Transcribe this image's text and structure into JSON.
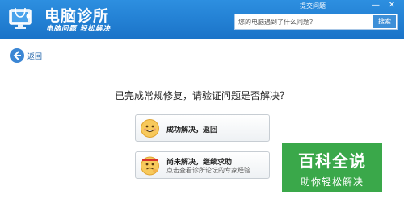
{
  "header": {
    "title": "电脑诊所",
    "subtitle": "电脑问题 轻松解决",
    "submit_link": "提交问题",
    "search": {
      "placeholder": "您的电脑遇到了什么问题？",
      "button": "搜索"
    }
  },
  "nav": {
    "back_label": "返回"
  },
  "main": {
    "question": "已完成常规修复，请验证问题是否解决？",
    "options": [
      {
        "label": "成功解决，返回",
        "sub": ""
      },
      {
        "label": "尚未解决，继续求助",
        "sub": "点击查看诊所论坛的专家经验"
      }
    ]
  },
  "watermark": {
    "title": "百科全说",
    "subtitle": "助你轻松解决"
  },
  "colors": {
    "header": "#1a73c8",
    "accent": "#3b86d4",
    "watermark": "#3aa84a"
  }
}
